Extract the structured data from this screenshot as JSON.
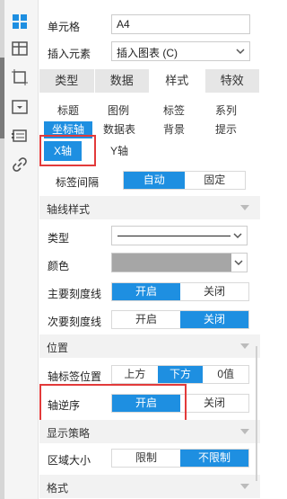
{
  "rail": {
    "icons": [
      {
        "name": "cell-properties-icon",
        "active": true
      },
      {
        "name": "widget-settings-icon",
        "active": false
      },
      {
        "name": "layout-frame-icon",
        "active": false
      },
      {
        "name": "dropdown-box-icon",
        "active": false
      },
      {
        "name": "data-card-icon",
        "active": false
      },
      {
        "name": "link-icon",
        "active": false
      }
    ]
  },
  "cell": {
    "label": "单元格",
    "value": "A4"
  },
  "insert": {
    "label": "插入元素",
    "value": "插入图表 (C)"
  },
  "tabs": [
    {
      "label": "类型",
      "active": false
    },
    {
      "label": "数据",
      "active": false
    },
    {
      "label": "样式",
      "active": true
    },
    {
      "label": "特效",
      "active": false
    }
  ],
  "subtabs_row1": [
    {
      "label": "标题",
      "active": false
    },
    {
      "label": "图例",
      "active": false
    },
    {
      "label": "标签",
      "active": false
    },
    {
      "label": "系列",
      "active": false
    }
  ],
  "subtabs_row2": [
    {
      "label": "坐标轴",
      "active": true
    },
    {
      "label": "数据表",
      "active": false
    },
    {
      "label": "背景",
      "active": false
    },
    {
      "label": "提示",
      "active": false
    }
  ],
  "axis_tabs": [
    {
      "label": "X轴",
      "active": true
    },
    {
      "label": "Y轴",
      "active": false
    }
  ],
  "label_interval": {
    "label": "标签间隔",
    "options": [
      "自动",
      "固定"
    ],
    "selected": 0
  },
  "axis_style": {
    "title": "轴线样式"
  },
  "line_type": {
    "label": "类型"
  },
  "line_color": {
    "label": "颜色",
    "swatch": "#a6a6a6"
  },
  "major_tick": {
    "label": "主要刻度线",
    "options": [
      "开启",
      "关闭"
    ],
    "selected": 0
  },
  "minor_tick": {
    "label": "次要刻度线",
    "options": [
      "开启",
      "关闭"
    ],
    "selected": 1
  },
  "position": {
    "title": "位置"
  },
  "axis_label_pos": {
    "label": "轴标签位置",
    "options": [
      "上方",
      "下方",
      "0值"
    ],
    "selected": 1
  },
  "axis_reverse": {
    "label": "轴逆序",
    "options": [
      "开启",
      "关闭"
    ],
    "selected": 0
  },
  "display_strategy": {
    "title": "显示策略"
  },
  "area_size": {
    "label": "区域大小",
    "options": [
      "限制",
      "不限制"
    ],
    "selected": 1
  },
  "format": {
    "title": "格式"
  },
  "colors": {
    "accent": "#1e8fe1",
    "highlight": "#e23a3a"
  }
}
